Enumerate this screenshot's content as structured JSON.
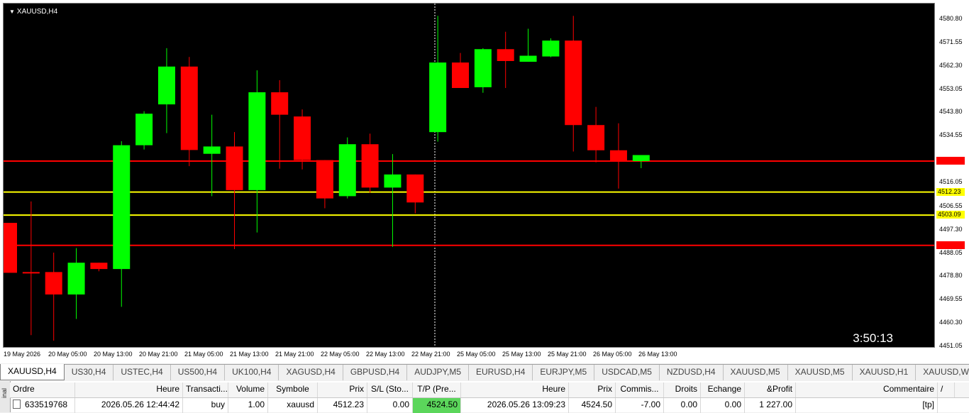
{
  "chart": {
    "symbol_label": "XAUUSD,H4",
    "countdown": "3:50:13",
    "background": "#000000",
    "bull_color": "#00ff00",
    "bear_color": "#ff0000",
    "price_axis": [
      "4580.80",
      "4571.55",
      "4562.30",
      "4553.05",
      "4543.80",
      "4534.55",
      "4516.05",
      "4506.55",
      "4497.30",
      "4488.05",
      "4478.80",
      "4469.55",
      "4460.30",
      "4451.05"
    ],
    "time_axis": [
      "19 May 2026",
      "20 May 05:00",
      "20 May 13:00",
      "20 May 21:00",
      "21 May 05:00",
      "21 May 13:00",
      "21 May 21:00",
      "22 May 05:00",
      "22 May 13:00",
      "22 May 21:00",
      "25 May 05:00",
      "25 May 13:00",
      "25 May 21:00",
      "26 May 05:00",
      "26 May 13:00"
    ],
    "levels": [
      {
        "label": "4524.50",
        "price": 4524.5,
        "color": "#ff0000",
        "tag_text": "#ff0000"
      },
      {
        "label": "4512.23",
        "price": 4512.23,
        "color": "#ffff00",
        "tag_text": "#000000"
      },
      {
        "label": "4503.09",
        "price": 4503.09,
        "color": "#ffff00",
        "tag_text": "#000000"
      },
      {
        "label": "4491.08",
        "price": 4491.08,
        "color": "#ff0000",
        "tag_text": "#ff0000"
      }
    ]
  },
  "chart_data": {
    "type": "candlestick",
    "title": "XAUUSD,H4",
    "ylim": [
      4451.05,
      4585
    ],
    "candles": [
      {
        "o": 4500.0,
        "h": 4500.0,
        "l": 4480.2,
        "c": 4480.2
      },
      {
        "o": 4480.5,
        "h": 4508.5,
        "l": 4455.5,
        "c": 4480.0
      },
      {
        "o": 4480.5,
        "h": 4488.2,
        "l": 4453.3,
        "c": 4471.6
      },
      {
        "o": 4471.6,
        "h": 4490.0,
        "l": 4461.9,
        "c": 4484.2
      },
      {
        "o": 4484.2,
        "h": 4484.2,
        "l": 4480.8,
        "c": 4481.7
      },
      {
        "o": 4481.7,
        "h": 4532.4,
        "l": 4466.7,
        "c": 4530.8
      },
      {
        "o": 4530.8,
        "h": 4544.3,
        "l": 4529.1,
        "c": 4543.3
      },
      {
        "o": 4547.0,
        "h": 4569.3,
        "l": 4535.6,
        "c": 4562.0
      },
      {
        "o": 4562.0,
        "h": 4565.8,
        "l": 4522.5,
        "c": 4528.9
      },
      {
        "o": 4527.4,
        "h": 4542.9,
        "l": 4510.6,
        "c": 4530.3
      },
      {
        "o": 4530.3,
        "h": 4536.0,
        "l": 4489.6,
        "c": 4513.0
      },
      {
        "o": 4513.0,
        "h": 4560.5,
        "l": 4496.2,
        "c": 4551.8
      },
      {
        "o": 4551.8,
        "h": 4556.6,
        "l": 4521.5,
        "c": 4542.9
      },
      {
        "o": 4542.2,
        "h": 4545.0,
        "l": 4521.2,
        "c": 4524.9
      },
      {
        "o": 4524.9,
        "h": 4524.9,
        "l": 4505.8,
        "c": 4509.7
      },
      {
        "o": 4510.6,
        "h": 4533.9,
        "l": 4509.7,
        "c": 4531.2
      },
      {
        "o": 4531.2,
        "h": 4535.4,
        "l": 4512.0,
        "c": 4514.0
      },
      {
        "o": 4514.0,
        "h": 4527.3,
        "l": 4490.5,
        "c": 4519.2
      },
      {
        "o": 4519.2,
        "h": 4519.2,
        "l": 4503.8,
        "c": 4508.1
      },
      {
        "o": 4536.0,
        "h": 4582.1,
        "l": 4532.2,
        "c": 4563.6
      },
      {
        "o": 4563.6,
        "h": 4567.4,
        "l": 4553.8,
        "c": 4553.5
      },
      {
        "o": 4553.8,
        "h": 4569.3,
        "l": 4551.6,
        "c": 4568.9
      },
      {
        "o": 4568.9,
        "h": 4575.8,
        "l": 4553.5,
        "c": 4564.2
      },
      {
        "o": 4563.9,
        "h": 4577.0,
        "l": 4563.9,
        "c": 4566.3
      },
      {
        "o": 4566.0,
        "h": 4573.2,
        "l": 4565.7,
        "c": 4572.3
      },
      {
        "o": 4572.3,
        "h": 4582.1,
        "l": 4528.3,
        "c": 4538.8
      },
      {
        "o": 4538.8,
        "h": 4546.0,
        "l": 4524.0,
        "c": 4528.8
      },
      {
        "o": 4528.8,
        "h": 4539.5,
        "l": 4513.6,
        "c": 4524.5
      },
      {
        "o": 4524.5,
        "h": 4526.9,
        "l": 4521.7,
        "c": 4526.9
      }
    ]
  },
  "tabs": [
    "XAUUSD,H4",
    "US30,H4",
    "USTEC,H4",
    "US500,H4",
    "UK100,H4",
    "XAGUSD,H4",
    "GBPUSD,H4",
    "AUDJPY,M5",
    "EURUSD,H4",
    "EURJPY,M5",
    "USDCAD,M5",
    "NZDUSD,H4",
    "XAUUSD,M5",
    "XAUUSD,M5",
    "XAUUSD,H1",
    "XAUUSD,Weekly"
  ],
  "tab_arrows": "◂ ▸",
  "terminal": {
    "side_label": "inal",
    "headers": [
      "Ordre",
      "Heure",
      "Transacti...",
      "Volume",
      "Symbole",
      "Prix",
      "S/L (Sto...",
      "T/P (Pre...",
      "Heure",
      "Prix",
      "Commis...",
      "Droits",
      "Echange",
      "&Profit",
      "Commentaire"
    ],
    "header_extra": "/",
    "row": [
      "633519768",
      "2026.05.26 12:44:42",
      "buy",
      "1.00",
      "xauusd",
      "4512.23",
      "0.00",
      "4524.50",
      "2026.05.26 13:09:23",
      "4524.50",
      "-7.00",
      "0.00",
      "0.00",
      "1 227.00",
      "[tp]"
    ]
  }
}
